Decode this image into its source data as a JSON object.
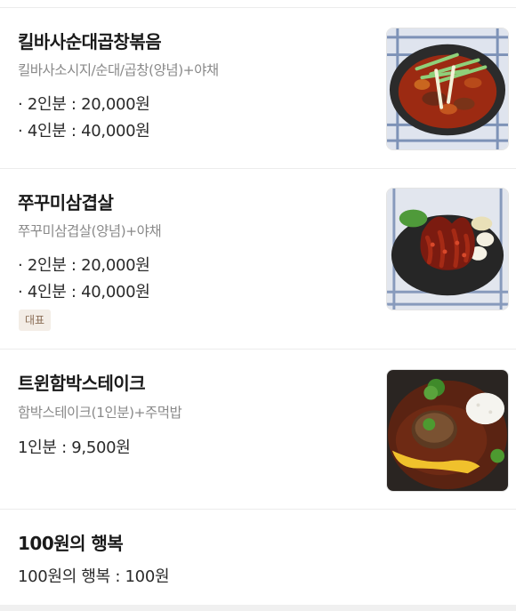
{
  "menu": [
    {
      "title": "킬바사순대곱창볶음",
      "desc": "킬바사소시지/순대/곱창(양념)+야채",
      "prices": [
        "· 2인분 : 20,000원",
        "· 4인분 : 40,000원"
      ],
      "image_icon": "stir-fry-dish-photo"
    },
    {
      "title": "쭈꾸미삼겹살",
      "desc": "쭈꾸미삼겹살(양념)+야채",
      "prices": [
        "· 2인분 : 20,000원",
        "· 4인분 : 40,000원"
      ],
      "badge": "대표",
      "image_icon": "webfoot-octopus-dish-photo"
    },
    {
      "title": "트윈함박스테이크",
      "desc": "함박스테이크(1인분)+주먹밥",
      "prices": [
        "1인분 : 9,500원"
      ],
      "image_icon": "hamburg-steak-photo"
    },
    {
      "title": "100원의 행복",
      "prices": [
        "100원의 행복 : 100원"
      ]
    }
  ],
  "colors": {
    "badge_bg": "#f3ede6",
    "badge_text": "#8a6d55",
    "divider": "#ececec",
    "desc_text": "#8a8a8a"
  }
}
